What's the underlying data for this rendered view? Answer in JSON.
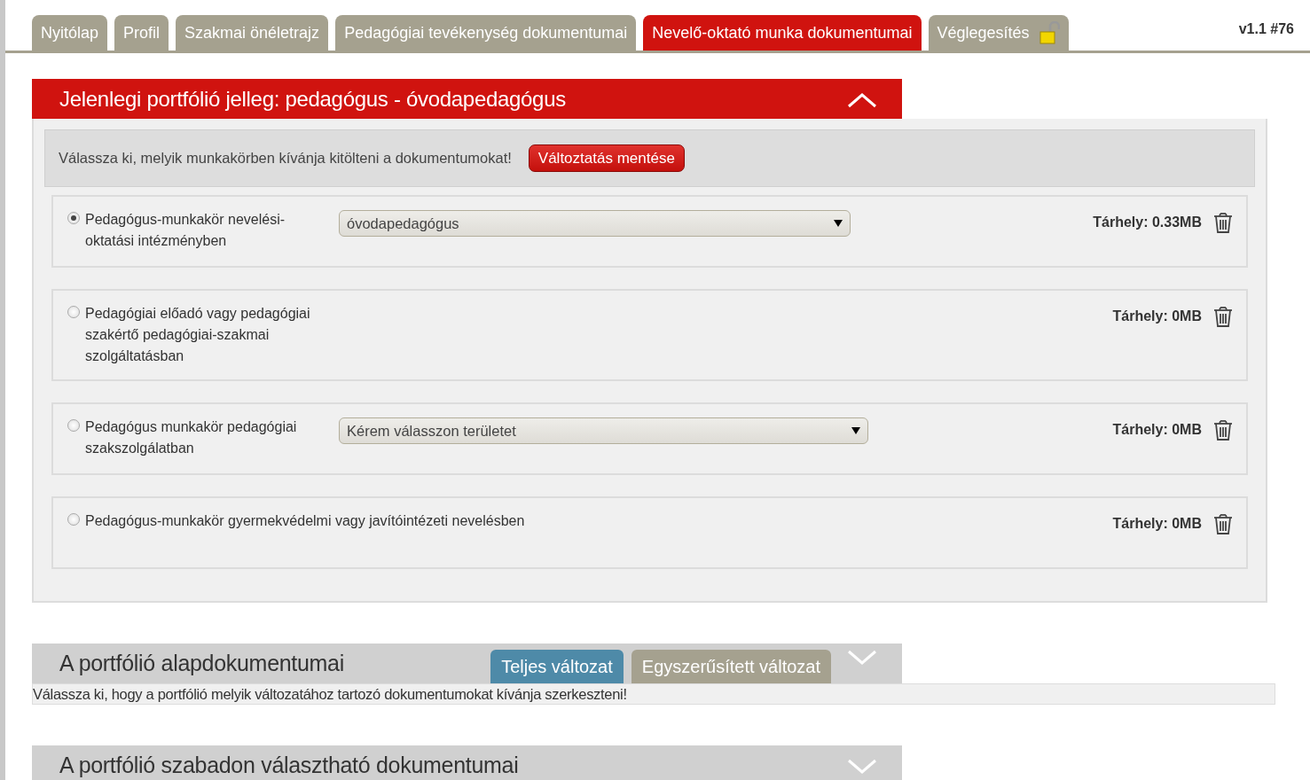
{
  "tabs": [
    {
      "label": "Nyitólap",
      "selected": false,
      "kind": "page"
    },
    {
      "label": "Profil",
      "selected": false,
      "kind": "page"
    },
    {
      "label": "Szakmai önéletrajz",
      "selected": false,
      "kind": "page"
    },
    {
      "label": "Pedagógiai tevékenység dokumentumai",
      "selected": false,
      "kind": "page"
    },
    {
      "label": "Nevelő-oktató munka dokumentumai",
      "selected": true,
      "kind": "page"
    },
    {
      "label": "Véglegesítés",
      "selected": false,
      "kind": "lock",
      "locked": false
    }
  ],
  "version": "v1.1 #76",
  "sections": [
    {
      "title": "Jelenlegi portfólió jelleg: pedagógus - óvodapedagógus",
      "expanded": true,
      "kind": "roles",
      "prompt": "Válassza ki, melyik munkakörben kívánja kitölteni a dokumentumokat!",
      "save_button": "Változtatás mentése",
      "roles": [
        {
          "label": "Pedagógus-munkakör nevelési-oktatási intézményben",
          "selected": true,
          "select": "óvodapedagógus",
          "storage": "Tárhely: 0.33MB"
        },
        {
          "label": "Pedagógiai előadó vagy pedagógiai szakértő pedagógiai-szakmai szolgáltatásban",
          "selected": false,
          "storage": "Tárhely: 0MB"
        },
        {
          "label": "Pedagógus munkakör pedagógiai szakszolgálatban",
          "selected": false,
          "select": "Kérem válasszon területet",
          "storage": "Tárhely: 0MB"
        },
        {
          "label": "Pedagógus-munkakör gyermekvédelmi vagy javítóintézeti nevelésben",
          "selected": false,
          "storage": "Tárhely: 0MB"
        }
      ]
    },
    {
      "title": "A portfólió alapdokumentumai",
      "expanded": false,
      "kind": "variants",
      "variants": [
        {
          "label": "Teljes változat",
          "selected": true
        },
        {
          "label": "Egyszerűsített változat",
          "selected": false
        }
      ],
      "note": "Válassza ki, hogy a portfólió melyik változatához tartozó dokumentumokat kívánja szerkeszteni!"
    },
    {
      "title": "A portfólió szabadon választható dokumentumai",
      "expanded": false,
      "kind": "plain"
    }
  ]
}
